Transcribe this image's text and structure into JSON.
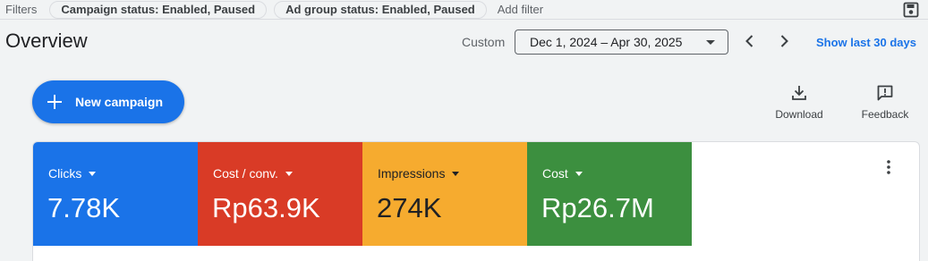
{
  "filters": {
    "label": "Filters",
    "chips": [
      {
        "label": "Campaign status: Enabled, Paused"
      },
      {
        "label": "Ad group status: Enabled, Paused"
      }
    ],
    "add_filter": "Add filter",
    "save_icon": "save-icon"
  },
  "header": {
    "title": "Overview",
    "date_label": "Custom",
    "date_range": "Dec 1, 2024 – Apr 30, 2025",
    "show_last": "Show last 30 days"
  },
  "actions": {
    "new_campaign": "New campaign",
    "download": "Download",
    "feedback": "Feedback"
  },
  "metrics": [
    {
      "name": "Clicks",
      "value": "7.78K",
      "color": "#1a73e8"
    },
    {
      "name": "Cost / conv.",
      "value": "Rp63.9K",
      "color": "#d93b26"
    },
    {
      "name": "Impressions",
      "value": "274K",
      "color": "#f6ab2f"
    },
    {
      "name": "Cost",
      "value": "Rp26.7M",
      "color": "#3c8f3f"
    }
  ],
  "colors": {
    "accent": "#1a73e8",
    "background": "#f1f3f4"
  }
}
